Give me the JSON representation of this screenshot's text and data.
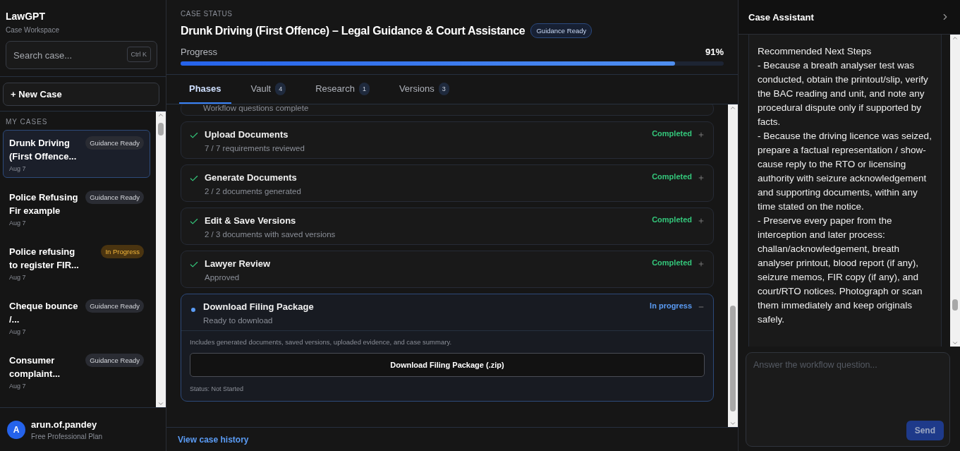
{
  "sidebar": {
    "brand": "LawGPT",
    "subtitle": "Case Workspace",
    "search": {
      "placeholder": "Search case...",
      "shortcut": "Ctrl K"
    },
    "new_case": "+ New Case",
    "section_title": "MY CASES",
    "cases": [
      {
        "title": "Drunk Driving (First Offence...",
        "date": "Aug 7",
        "badge": "Guidance Ready",
        "kind": "ready",
        "selected": true
      },
      {
        "title": "Police Refusing Fir example",
        "date": "Aug 7",
        "badge": "Guidance Ready",
        "kind": "ready",
        "selected": false
      },
      {
        "title": "Police refusing to register FIR...",
        "date": "Aug 7",
        "badge": "In Progress",
        "kind": "progress",
        "selected": false
      },
      {
        "title": "Cheque bounce /...",
        "date": "Aug 7",
        "badge": "Guidance Ready",
        "kind": "ready",
        "selected": false
      },
      {
        "title": "Consumer complaint...",
        "date": "Aug 7",
        "badge": "Guidance Ready",
        "kind": "ready",
        "selected": false
      }
    ],
    "user": {
      "initial": "A",
      "name": "arun.of.pandey",
      "plan": "Free Professional Plan"
    }
  },
  "header": {
    "eyebrow": "CASE STATUS",
    "title": "Drunk Driving (First Offence) – Legal Guidance & Court Assistance",
    "badge": "Guidance Ready",
    "progress_label": "Progress",
    "progress_value": "91%",
    "level": 0.91
  },
  "tabs": [
    {
      "label": "Phases",
      "selected": true
    },
    {
      "label": "Vault",
      "count": "4",
      "selected": false
    },
    {
      "label": "Research",
      "count": "1",
      "selected": false
    },
    {
      "label": "Versions",
      "count": "3",
      "selected": false
    }
  ],
  "phases": [
    {
      "kind": "partial",
      "subtitle": "Workflow questions complete"
    },
    {
      "kind": "completed",
      "title": "Upload Documents",
      "subtitle": "7 / 7 requirements reviewed",
      "status": "Completed",
      "expanded": false
    },
    {
      "kind": "completed",
      "title": "Generate Documents",
      "subtitle": "2 / 2 documents generated",
      "status": "Completed",
      "expanded": false
    },
    {
      "kind": "completed",
      "title": "Edit & Save Versions",
      "subtitle": "2 / 3 documents with saved versions",
      "status": "Completed",
      "expanded": false
    },
    {
      "kind": "completed",
      "title": "Lawyer Review",
      "subtitle": "Approved",
      "status": "Completed",
      "expanded": false
    },
    {
      "kind": "in_progress",
      "title": "Download Filing Package",
      "subtitle": "Ready to download",
      "status": "In progress",
      "expanded": true,
      "description": "Includes generated documents, saved versions, uploaded evidence, and case summary.",
      "button": "Download Filing Package (.zip)",
      "footnote": "Status: Not Started"
    }
  ],
  "history_link": "View case history",
  "assistant": {
    "title": "Case Assistant",
    "lines": [
      "Recommended Next Steps",
      "- Because a breath analyser test was conducted, obtain the printout/slip, verify the BAC reading and unit, and note any procedural dispute only if supported by facts.",
      "- Because the driving licence was seized, prepare a factual representation / show-cause reply to the RTO or licensing authority with seizure acknowledgement and supporting documents, within any time stated on the notice.",
      "- Preserve every paper from the interception and later process: challan/acknowledgement, breath analyser printout, blood report (if any), seizure memos, FIR copy (if any), and court/RTO notices. Photograph or scan them immediately and keep originals safely."
    ],
    "input": {
      "placeholder": "Answer the workflow question..."
    },
    "send": "Send"
  }
}
